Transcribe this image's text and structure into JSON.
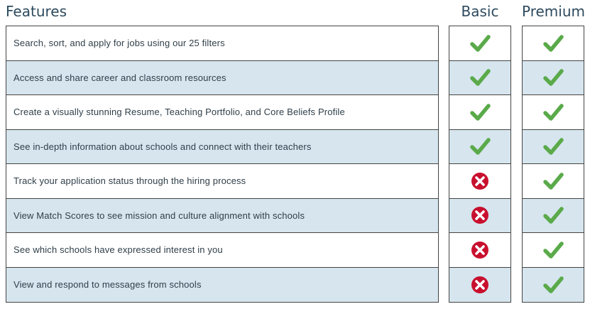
{
  "header": {
    "features_label": "Features",
    "basic_label": "Basic",
    "premium_label": "Premium"
  },
  "colors": {
    "check": "#5aaa4a",
    "cross": "#c8102e",
    "row_alt": "#d6e5ee",
    "header_text": "#2d4a5e"
  },
  "features": [
    {
      "text": "Search, sort, and apply for jobs using our 25 filters",
      "basic": "check-icon",
      "premium": "check-icon"
    },
    {
      "text": "Access and share career and classroom resources",
      "basic": "check-icon",
      "premium": "check-icon"
    },
    {
      "text": "Create a visually stunning Resume, Teaching Portfolio, and Core Beliefs Profile",
      "basic": "check-icon",
      "premium": "check-icon"
    },
    {
      "text": "See in-depth information about schools and connect with their teachers",
      "basic": "check-icon",
      "premium": "check-icon"
    },
    {
      "text": "Track your application status through the hiring process",
      "basic": "cross-icon",
      "premium": "check-icon"
    },
    {
      "text": "View Match Scores to see mission and culture alignment with schools",
      "basic": "cross-icon",
      "premium": "check-icon"
    },
    {
      "text": "See which schools have expressed interest in you",
      "basic": "cross-icon",
      "premium": "check-icon"
    },
    {
      "text": "View and respond to messages from schools",
      "basic": "cross-icon",
      "premium": "check-icon"
    }
  ]
}
